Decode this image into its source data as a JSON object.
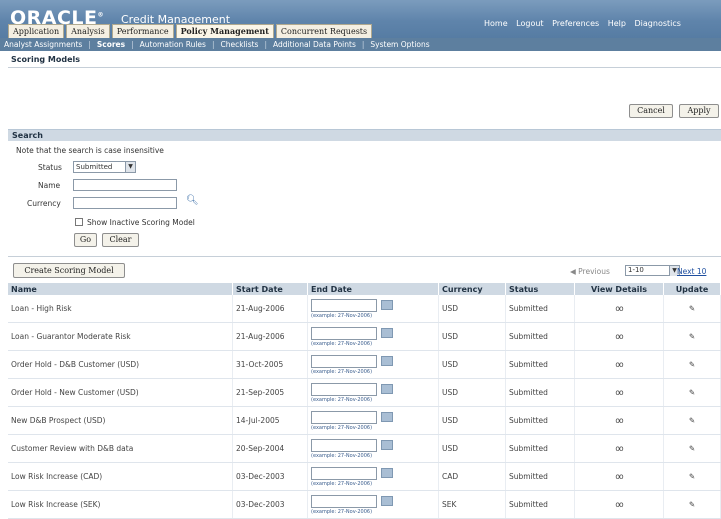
{
  "header": {
    "logo": "ORACLE",
    "app_title": "Credit Management",
    "global_links": [
      "Home",
      "Logout",
      "Preferences",
      "Help",
      "Diagnostics"
    ]
  },
  "tabs": [
    {
      "label": "Application",
      "active": false
    },
    {
      "label": "Analysis",
      "active": false
    },
    {
      "label": "Performance",
      "active": false
    },
    {
      "label": "Policy Management",
      "active": true
    },
    {
      "label": "Concurrent Requests",
      "active": false
    }
  ],
  "subtabs": [
    {
      "label": "Analyst Assignments",
      "active": false
    },
    {
      "label": "Scores",
      "active": true
    },
    {
      "label": "Automation Rules",
      "active": false
    },
    {
      "label": "Checklists",
      "active": false
    },
    {
      "label": "Additional Data Points",
      "active": false
    },
    {
      "label": "System Options",
      "active": false
    }
  ],
  "page_title": "Scoring Models",
  "buttons": {
    "cancel": "Cancel",
    "apply": "Apply"
  },
  "search": {
    "header": "Search",
    "note": "Note that the search is case insensitive",
    "status_label": "Status",
    "status_value": "Submitted",
    "name_label": "Name",
    "currency_label": "Currency",
    "show_inactive_label": "Show Inactive Scoring Model",
    "go": "Go",
    "clear": "Clear"
  },
  "results": {
    "create_button": "Create Scoring Model",
    "pager_previous": "Previous",
    "pager_range": "1-10",
    "pager_next": "Next 10",
    "columns": [
      "Name",
      "Start Date",
      "End Date",
      "Currency",
      "Status",
      "View Details",
      "Update"
    ],
    "example_text": "(example: 27-Nov-2006)",
    "rows": [
      {
        "name": "Loan - High Risk",
        "start": "21-Aug-2006",
        "currency": "USD",
        "status": "Submitted"
      },
      {
        "name": "Loan - Guarantor Moderate Risk",
        "start": "21-Aug-2006",
        "currency": "USD",
        "status": "Submitted"
      },
      {
        "name": "Order Hold - D&B Customer (USD)",
        "start": "31-Oct-2005",
        "currency": "USD",
        "status": "Submitted"
      },
      {
        "name": "Order Hold - New Customer (USD)",
        "start": "21-Sep-2005",
        "currency": "USD",
        "status": "Submitted"
      },
      {
        "name": "New D&B Prospect (USD)",
        "start": "14-Jul-2005",
        "currency": "USD",
        "status": "Submitted"
      },
      {
        "name": "Customer Review with D&B data",
        "start": "20-Sep-2004",
        "currency": "USD",
        "status": "Submitted"
      },
      {
        "name": "Low Risk Increase (CAD)",
        "start": "03-Dec-2003",
        "currency": "CAD",
        "status": "Submitted"
      },
      {
        "name": "Low Risk Increase (SEK)",
        "start": "03-Dec-2003",
        "currency": "SEK",
        "status": "Submitted"
      }
    ]
  }
}
